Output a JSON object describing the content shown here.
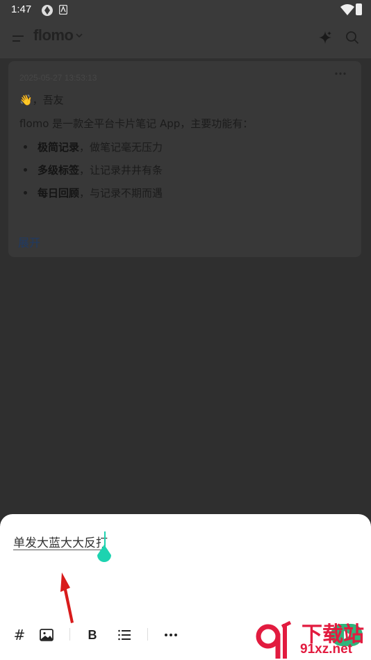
{
  "status_bar": {
    "time": "1:47"
  },
  "header": {
    "app_name": "flomo"
  },
  "memo": {
    "date": "2025-05-27 13:53:13",
    "greeting": "👋，吾友",
    "intro": "flomo 是一款全平台卡片笔记 App，主要功能有：",
    "features": [
      {
        "title": "极简记录",
        "desc": "，做笔记毫无压力"
      },
      {
        "title": "多级标签",
        "desc": "，让记录井井有条"
      },
      {
        "title": "每日回顾",
        "desc": "，与记录不期而遇"
      }
    ],
    "expand_label": "展开"
  },
  "editor": {
    "text": "单发大蓝大大反打",
    "toolbar": {
      "tag_symbol": "#",
      "bold_symbol": "B"
    }
  },
  "watermark": {
    "line1": "下载站",
    "line2": "91xz.net"
  }
}
